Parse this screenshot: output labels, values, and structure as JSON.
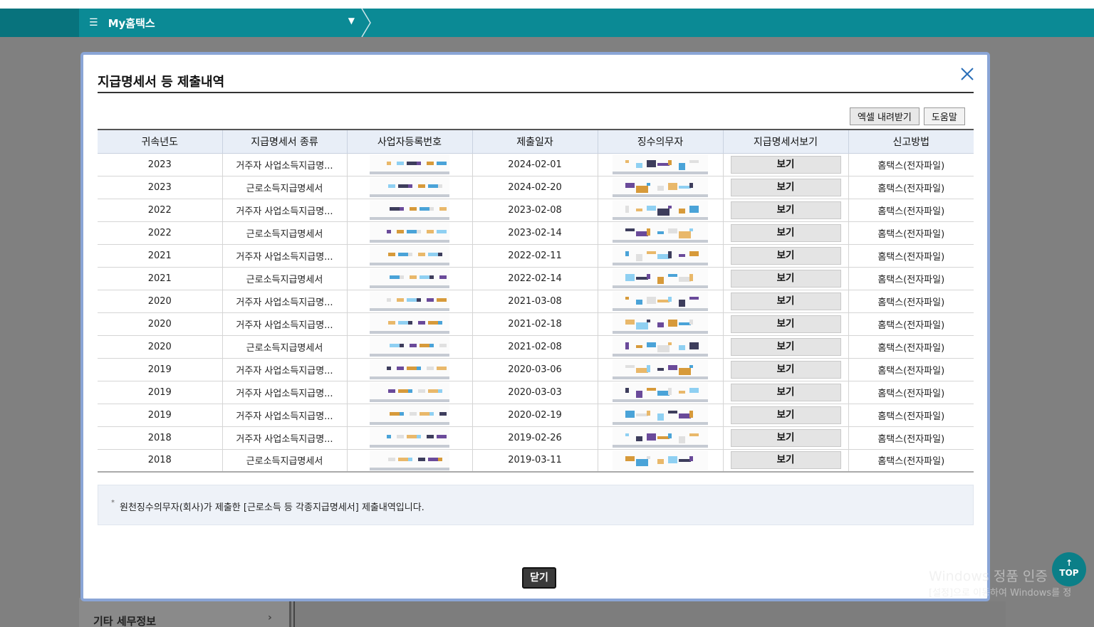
{
  "nav": {
    "menu_icon": "hamburger-icon",
    "title": "My홈택스",
    "dropdown_icon": "chevron-down-icon"
  },
  "background": {
    "side_item": "기타 세무정보"
  },
  "modal": {
    "title": "지급명세서 등 제출내역",
    "excel_button": "엑셀 내려받기",
    "help_button": "도움말",
    "columns": [
      "귀속년도",
      "지급명세서 종류",
      "사업자등록번호",
      "제출일자",
      "징수의무자",
      "지급명세서보기",
      "신고방법"
    ],
    "rows": [
      {
        "year": "2023",
        "kind": "거주자 사업소득지급명...",
        "date": "2024-02-01",
        "view": "보기",
        "method": "홈택스(전자파일)"
      },
      {
        "year": "2023",
        "kind": "근로소득지급명세서",
        "date": "2024-02-20",
        "view": "보기",
        "method": "홈택스(전자파일)"
      },
      {
        "year": "2022",
        "kind": "거주자 사업소득지급명...",
        "date": "2023-02-08",
        "view": "보기",
        "method": "홈택스(전자파일)"
      },
      {
        "year": "2022",
        "kind": "근로소득지급명세서",
        "date": "2023-02-14",
        "view": "보기",
        "method": "홈택스(전자파일)"
      },
      {
        "year": "2021",
        "kind": "거주자 사업소득지급명...",
        "date": "2022-02-11",
        "view": "보기",
        "method": "홈택스(전자파일)"
      },
      {
        "year": "2021",
        "kind": "근로소득지급명세서",
        "date": "2022-02-14",
        "view": "보기",
        "method": "홈택스(전자파일)"
      },
      {
        "year": "2020",
        "kind": "거주자 사업소득지급명...",
        "date": "2021-03-08",
        "view": "보기",
        "method": "홈택스(전자파일)"
      },
      {
        "year": "2020",
        "kind": "거주자 사업소득지급명...",
        "date": "2021-02-18",
        "view": "보기",
        "method": "홈택스(전자파일)"
      },
      {
        "year": "2020",
        "kind": "근로소득지급명세서",
        "date": "2021-02-08",
        "view": "보기",
        "method": "홈택스(전자파일)"
      },
      {
        "year": "2019",
        "kind": "거주자 사업소득지급명...",
        "date": "2020-03-06",
        "view": "보기",
        "method": "홈택스(전자파일)"
      },
      {
        "year": "2019",
        "kind": "거주자 사업소득지급명...",
        "date": "2020-03-03",
        "view": "보기",
        "method": "홈택스(전자파일)"
      },
      {
        "year": "2019",
        "kind": "거주자 사업소득지급명...",
        "date": "2020-02-19",
        "view": "보기",
        "method": "홈택스(전자파일)"
      },
      {
        "year": "2018",
        "kind": "거주자 사업소득지급명...",
        "date": "2019-02-26",
        "view": "보기",
        "method": "홈택스(전자파일)"
      },
      {
        "year": "2018",
        "kind": "근로소득지급명세서",
        "date": "2019-03-11",
        "view": "보기",
        "method": "홈택스(전자파일)"
      }
    ],
    "note": "원천징수의무자(회사)가 제출한 [근로소득 등 각종지급명세서] 제출내역입니다.",
    "close_button": "닫기",
    "close_icon": "close-icon"
  },
  "watermark": {
    "line1": "Windows 정품 인증",
    "line2": "[설정]으로 이동하여 Windows를 정"
  },
  "top_button": "TOP",
  "colors": {
    "nav": "#0b8a95",
    "modal_border": "#8aa5d6",
    "header_bg": "#e8eef7"
  }
}
